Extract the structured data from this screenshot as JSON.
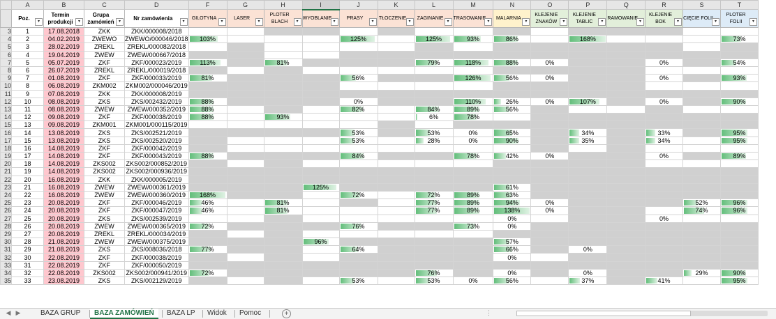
{
  "column_letters": [
    "A",
    "B",
    "C",
    "D",
    "F",
    "G",
    "H",
    "I",
    "J",
    "K",
    "L",
    "M",
    "N",
    "O",
    "P",
    "Q",
    "R",
    "S",
    "T"
  ],
  "headers": [
    {
      "label": "Poz.",
      "color": "#ffffff"
    },
    {
      "label": "Termin produkcji",
      "color": "#ffffff"
    },
    {
      "label": "Grupa zamówień",
      "color": "#ffffff"
    },
    {
      "label": "Nr zamówienia",
      "color": "#ffffff"
    },
    {
      "label": "GILOTYNA",
      "color": "#fbe2d5"
    },
    {
      "label": "LASER",
      "color": "#fbe2d5"
    },
    {
      "label": "PLOTER BLACH",
      "color": "#fbe2d5"
    },
    {
      "label": "WYOBLANIE",
      "color": "#fbe2d5"
    },
    {
      "label": "PRASY",
      "color": "#fbe2d5"
    },
    {
      "label": "TŁOCZENIE",
      "color": "#fbe2d5"
    },
    {
      "label": "ZAGINANIE",
      "color": "#fbe2d5"
    },
    {
      "label": "TRASOWANIE",
      "color": "#fbe2d5"
    },
    {
      "label": "MALARNIA",
      "color": "#fff2cc"
    },
    {
      "label": "KLEJENIE ZNAKÓW",
      "color": "#e2efda"
    },
    {
      "label": "KLEJENIE TABLIC",
      "color": "#e2efda"
    },
    {
      "label": "RAMOWANIE",
      "color": "#e2efda"
    },
    {
      "label": "KLEJENIE BOK",
      "color": "#e2efda"
    },
    {
      "label": "CIĘCIE FOLII",
      "color": "#ddebf7"
    },
    {
      "label": "PLOTER FOLII",
      "color": "#ddebf7"
    }
  ],
  "gray_mask": [
    "0110001101001011100",
    "0000000000000000000",
    "0001010000101111101",
    "1111110011111111111",
    "1011111111111111111",
    "0001101000001111000",
    "1111111111111111111",
    "0001111100001111000",
    "1111111111111111111",
    "1111111111111111111",
    "0001101000000100100",
    "0001000000010111111",
    "0001000001011111111",
    "1111111111111111111",
    "0001100000001101000",
    "0001100000000101000",
    "1111111111111111111",
    "0001101000001111000",
    "1111111111111111111",
    "1111111111111111111",
    "1111111111111111111",
    "1111111000111111111",
    "0001101010011111111",
    "0001001000001111000",
    "0001001000001011100",
    "1111111111111111111",
    "0001101000001111111",
    "1111111111111111111",
    "1111111011111111111",
    "0001101011111011111",
    "1111111111111111111",
    "1111111111111111111",
    "0001101000011011100",
    "0001101000000100000"
  ],
  "rows": [
    {
      "n": "1",
      "date": "17.08.2018",
      "group": "ZKK",
      "order": "ZKK/000008/2018",
      "p": {}
    },
    {
      "n": "2",
      "date": "04.02.2019",
      "group": "ZWEWO",
      "order": "ZWEWO/000046/2018",
      "p": {
        "F": 103,
        "J": 125,
        "L": 125,
        "M": 93,
        "N": 86,
        "P": 168,
        "T": 73
      }
    },
    {
      "n": "3",
      "date": "28.02.2019",
      "group": "ZREKL",
      "order": "ZREKL/000082/2018",
      "p": {}
    },
    {
      "n": "4",
      "date": "19.04.2019",
      "group": "ZWEW",
      "order": "ZWEW/000667/2018",
      "p": {}
    },
    {
      "n": "5",
      "date": "05.07.2019",
      "group": "ZKF",
      "order": "ZKF/000023/2019",
      "p": {
        "F": 113,
        "H": 81,
        "L": 79,
        "M": 118,
        "N": 88,
        "O": 0,
        "R": 0,
        "T": 54
      }
    },
    {
      "n": "6",
      "date": "26.07.2019",
      "group": "ZREKL",
      "order": "ZREKL/000019/2018",
      "p": {}
    },
    {
      "n": "7",
      "date": "01.08.2019",
      "group": "ZKF",
      "order": "ZKF/000033/2019",
      "p": {
        "F": 81,
        "J": 56,
        "M": 126,
        "N": 56,
        "O": 0,
        "R": 0,
        "T": 93
      }
    },
    {
      "n": "8",
      "date": "06.08.2019",
      "group": "ZKM002",
      "order": "ZKM002/000046/2019",
      "p": {}
    },
    {
      "n": "9",
      "date": "07.08.2019",
      "group": "ZKK",
      "order": "ZKK/000008/2019",
      "p": {}
    },
    {
      "n": "10",
      "date": "08.08.2019",
      "group": "ZKS",
      "order": "ZKS/002432/2019",
      "p": {
        "F": 88,
        "J": 0,
        "M": 110,
        "N": 26,
        "O": 0,
        "P": 107,
        "R": 0,
        "T": 90
      }
    },
    {
      "n": "11",
      "date": "08.08.2019",
      "group": "ZWEW",
      "order": "ZWEW/000352/2019",
      "p": {
        "F": 88,
        "J": 82,
        "L": 84,
        "M": 89,
        "N": 56
      }
    },
    {
      "n": "12",
      "date": "09.08.2019",
      "group": "ZKF",
      "order": "ZKF/000038/2019",
      "p": {
        "F": 88,
        "H": 93,
        "L": 6,
        "M": 78
      }
    },
    {
      "n": "13",
      "date": "09.08.2019",
      "group": "ZKM001",
      "order": "ZKM001/000115/2019",
      "p": {}
    },
    {
      "n": "14",
      "date": "13.08.2019",
      "group": "ZKS",
      "order": "ZKS/002521/2019",
      "p": {
        "J": 53,
        "L": 53,
        "M": 0,
        "N": 65,
        "P": 34,
        "R": 33,
        "T": 95
      }
    },
    {
      "n": "15",
      "date": "13.08.2019",
      "group": "ZKS",
      "order": "ZKS/002520/2019",
      "p": {
        "J": 53,
        "L": 28,
        "M": 0,
        "N": 90,
        "P": 35,
        "R": 34,
        "T": 95
      }
    },
    {
      "n": "16",
      "date": "14.08.2019",
      "group": "ZKF",
      "order": "ZKF/000042/2019",
      "p": {}
    },
    {
      "n": "17",
      "date": "14.08.2019",
      "group": "ZKF",
      "order": "ZKF/000043/2019",
      "p": {
        "F": 88,
        "J": 84,
        "M": 78,
        "N": 42,
        "O": 0,
        "R": 0,
        "T": 89
      }
    },
    {
      "n": "18",
      "date": "14.08.2019",
      "group": "ZKS002",
      "order": "ZKS002/000852/2019",
      "p": {}
    },
    {
      "n": "19",
      "date": "14.08.2019",
      "group": "ZKS002",
      "order": "ZKS002/000936/2019",
      "p": {}
    },
    {
      "n": "20",
      "date": "16.08.2019",
      "group": "ZKK",
      "order": "ZKK/000005/2019",
      "p": {}
    },
    {
      "n": "21",
      "date": "16.08.2019",
      "group": "ZWEW",
      "order": "ZWEW/000361/2019",
      "p": {
        "I": 125,
        "N": 61
      }
    },
    {
      "n": "22",
      "date": "16.08.2019",
      "group": "ZWEW",
      "order": "ZWEW/000360/2019",
      "p": {
        "F": 168,
        "J": 72,
        "L": 72,
        "M": 89,
        "N": 63
      }
    },
    {
      "n": "23",
      "date": "20.08.2019",
      "group": "ZKF",
      "order": "ZKF/000046/2019",
      "p": {
        "F": 46,
        "H": 81,
        "L": 77,
        "M": 89,
        "N": 94,
        "O": 0,
        "S": 52,
        "T": 96
      }
    },
    {
      "n": "24",
      "date": "20.08.2019",
      "group": "ZKF",
      "order": "ZKF/000047/2019",
      "p": {
        "F": 46,
        "H": 81,
        "L": 77,
        "M": 89,
        "N": 138,
        "O": 0,
        "S": 74,
        "T": 96
      }
    },
    {
      "n": "25",
      "date": "20.08.2019",
      "group": "ZKS",
      "order": "ZKS/002539/2019",
      "p": {
        "N": 0,
        "R": 0
      }
    },
    {
      "n": "26",
      "date": "20.08.2019",
      "group": "ZWEW",
      "order": "ZWEW/000365/2019",
      "p": {
        "F": 72,
        "J": 76,
        "M": 73,
        "N": 0
      }
    },
    {
      "n": "27",
      "date": "20.08.2019",
      "group": "ZREKL",
      "order": "ZREKL/000034/2019",
      "p": {}
    },
    {
      "n": "28",
      "date": "21.08.2019",
      "group": "ZWEW",
      "order": "ZWEW/000375/2019",
      "p": {
        "I": 96,
        "N": 57
      }
    },
    {
      "n": "29",
      "date": "21.08.2019",
      "group": "ZKS",
      "order": "ZKS/008036/2018",
      "p": {
        "F": 77,
        "J": 64,
        "N": 66,
        "P": 0
      }
    },
    {
      "n": "30",
      "date": "22.08.2019",
      "group": "ZKF",
      "order": "ZKF/000038/2019",
      "p": {
        "N": 0
      }
    },
    {
      "n": "31",
      "date": "22.08.2019",
      "group": "ZKF",
      "order": "ZKF/000050/2019",
      "p": {}
    },
    {
      "n": "32",
      "date": "22.08.2019",
      "group": "ZKS002",
      "order": "ZKS002/000941/2019",
      "p": {
        "F": 72,
        "L": 76,
        "N": 0,
        "P": 0,
        "S": 29,
        "T": 90
      }
    },
    {
      "n": "33",
      "date": "23.08.2019",
      "group": "ZKS",
      "order": "ZKS/002129/2019",
      "p": {
        "J": 53,
        "L": 53,
        "M": 0,
        "N": 56,
        "P": 37,
        "R": 41,
        "T": 95
      }
    }
  ],
  "sheet_tabs": [
    {
      "label": "BAZA GRUP",
      "active": false
    },
    {
      "label": "BAZA ZAMÓWIEŃ",
      "active": true
    },
    {
      "label": "BAZA LP",
      "active": false
    },
    {
      "label": "Widok",
      "active": false
    },
    {
      "label": "Pomoc",
      "active": false
    }
  ],
  "tab_nav": {
    "prev": "◀",
    "next": "▶",
    "more": "⋮",
    "add": "+"
  },
  "filter_icon": "▾",
  "colors": {
    "date_fill": "#ffc7ce",
    "empty_cell_fill": "#d0d0d0",
    "databar": "#63be7b",
    "active_tab": "#217346"
  }
}
